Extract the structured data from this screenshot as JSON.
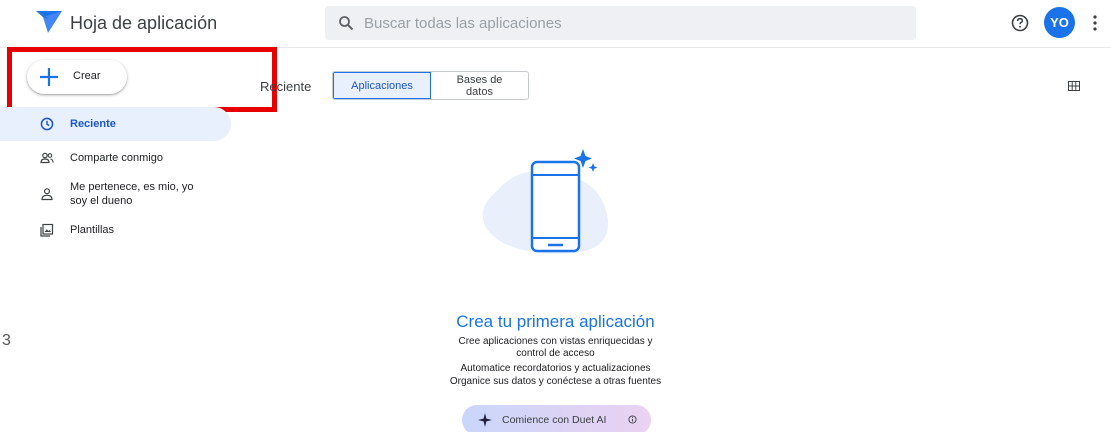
{
  "header": {
    "title": "Hoja de aplicación",
    "search_placeholder": "Buscar todas las aplicaciones",
    "help_icon": "help-circle-icon",
    "avatar_initials": "YO",
    "more_icon": "more-vert-icon",
    "logo_icon": "appsheet-logo-icon",
    "brand_color": "#1a73e8"
  },
  "sidebar": {
    "create_label": "Crear",
    "items": [
      {
        "label": "Reciente",
        "icon": "clock-icon",
        "active": true
      },
      {
        "label": "Comparte conmigo",
        "icon": "people-icon",
        "active": false
      },
      {
        "label_line1": "Me pertenece, es mio, yo",
        "label_line2": "soy el dueno",
        "icon": "person-icon",
        "active": false
      },
      {
        "label": "Plantillas",
        "icon": "template-icon",
        "active": false
      }
    ]
  },
  "main": {
    "recent_label": "Reciente",
    "tabs": [
      {
        "label": "Aplicaciones",
        "selected": true
      },
      {
        "label_line1": "Bases de",
        "label_line2": "datos",
        "selected": false
      }
    ],
    "view_toggle_icon": "grid-view-icon",
    "empty_state": {
      "illustration_icon": "phone-sparkle-icon",
      "title": "Crea tu primera aplicación",
      "lines": [
        "Cree aplicaciones con vistas enriquecidas y",
        "control de acceso",
        "Automatice recordatorios y actualizaciones",
        "Organice sus datos y conéctese a otras fuentes"
      ],
      "duet_button_label": "Comience con Duet AI",
      "duet_icon": "sparkle-icon",
      "info_icon": "info-icon"
    }
  },
  "annotation": {
    "highlight_color": "#e60000"
  },
  "stray_glyph": "3"
}
